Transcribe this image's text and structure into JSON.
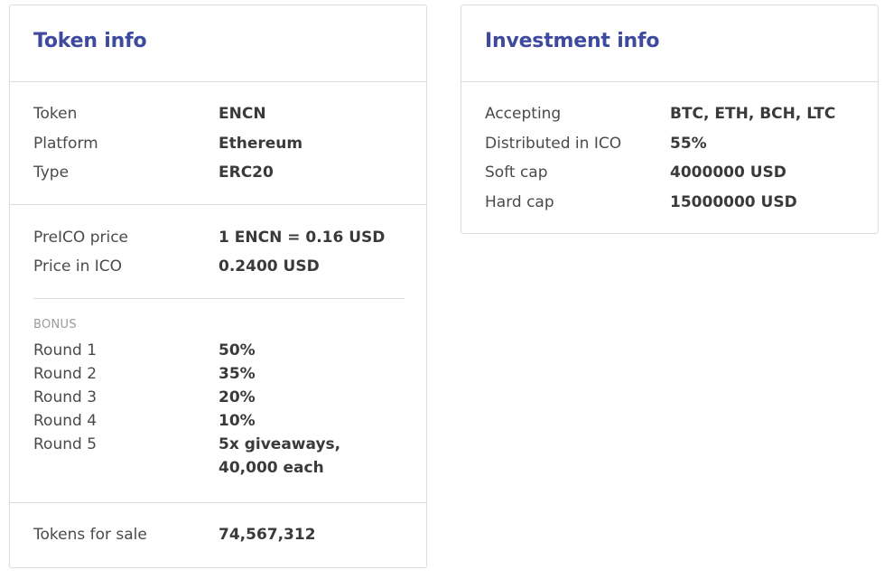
{
  "token_info": {
    "title": "Token info",
    "basic": [
      {
        "label": "Token",
        "value": "ENCN"
      },
      {
        "label": "Platform",
        "value": "Ethereum"
      },
      {
        "label": "Type",
        "value": "ERC20"
      }
    ],
    "prices": [
      {
        "label": "PreICO price",
        "value": "1 ENCN = 0.16 USD"
      },
      {
        "label": "Price in ICO",
        "value": "0.2400 USD"
      }
    ],
    "bonus_heading": "BONUS",
    "bonus_rounds": [
      {
        "label": "Round 1",
        "value": "50%"
      },
      {
        "label": "Round 2",
        "value": "35%"
      },
      {
        "label": "Round 3",
        "value": "20%"
      },
      {
        "label": "Round 4",
        "value": "10%"
      },
      {
        "label": "Round 5",
        "value": "5x giveaways, 40,000 each"
      }
    ],
    "tokens_for_sale": {
      "label": "Tokens for sale",
      "value": "74,567,312"
    }
  },
  "investment_info": {
    "title": "Investment info",
    "rows": [
      {
        "label": "Accepting",
        "value": "BTC, ETH, BCH, LTC"
      },
      {
        "label": "Distributed in ICO",
        "value": "55%"
      },
      {
        "label": "Soft cap",
        "value": "4000000 USD"
      },
      {
        "label": "Hard cap",
        "value": "15000000 USD"
      }
    ]
  }
}
